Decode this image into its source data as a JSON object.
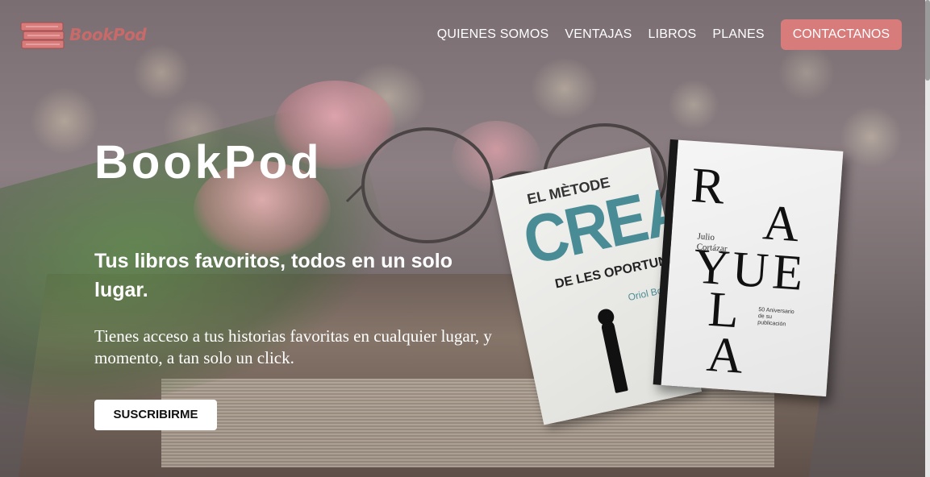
{
  "brand": {
    "name": "BookPod",
    "accent_color": "#d87b7b"
  },
  "nav": {
    "links": [
      "QUIENES SOMOS",
      "VENTAJAS",
      "LIBROS",
      "PLANES"
    ],
    "cta": "CONTACTANOS"
  },
  "hero": {
    "title": "BookPod",
    "subtitle": "Tus libros favoritos, todos en un solo lugar.",
    "description": "Tienes acceso a tus historias favoritas en cualquier lugar, y momento, a tan solo un click.",
    "button": "SUSCRIBIRME"
  },
  "books": [
    {
      "top_line": "EL MÈTODE",
      "big": "CREA",
      "bottom_line": "DE LES OPORTUNITAT",
      "author": "Oriol Bo"
    },
    {
      "letters": [
        "R",
        "A",
        "Y",
        "U",
        "E",
        "L",
        "A"
      ],
      "author_line1": "Julio",
      "author_line2": "Cortázar",
      "note": "50 Aniversario de su publicación"
    }
  ]
}
